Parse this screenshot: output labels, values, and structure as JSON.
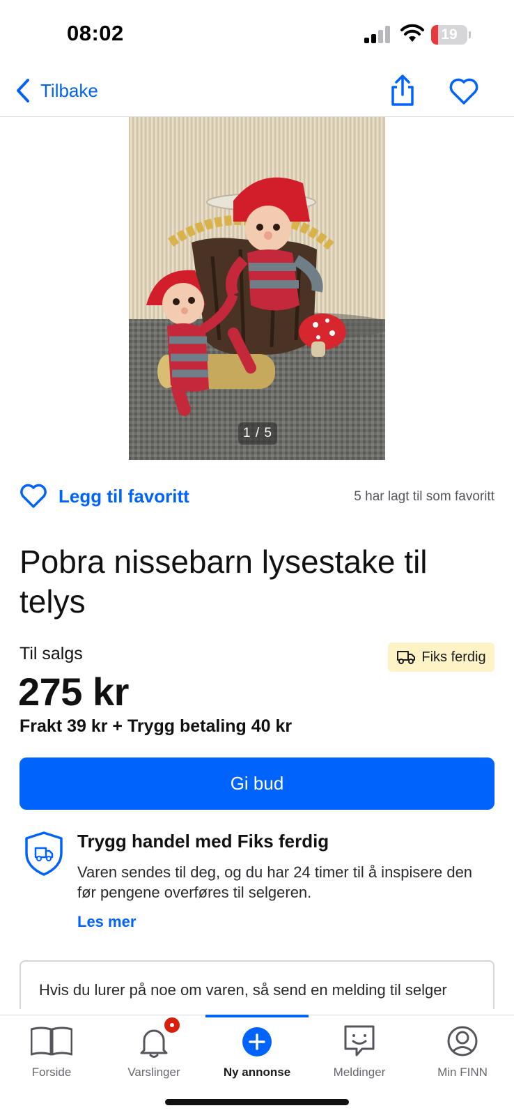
{
  "status_bar": {
    "time": "08:02",
    "battery_level": "19"
  },
  "nav": {
    "back_label": "Tilbake",
    "share_icon": "share-icon",
    "favorite_icon": "heart-outline-icon"
  },
  "gallery": {
    "counter": "1 / 5"
  },
  "favorite": {
    "add_label": "Legg til favoritt",
    "count_text": "5 har lagt til som favoritt"
  },
  "listing": {
    "title": "Pobra nissebarn lysestake til telys",
    "sale_label": "Til salgs",
    "badge_label": "Fiks ferdig",
    "price": "275 kr",
    "shipping": "Frakt 39 kr + Trygg betaling 40 kr"
  },
  "bid_button": {
    "label": "Gi bud"
  },
  "safe_trade": {
    "title": "Trygg handel med Fiks ferdig",
    "text": "Varen sendes til deg, og du har 24 timer til å inspisere den før pengene overføres til selgeren.",
    "read_more": "Les mer"
  },
  "message": {
    "text": "Hvis du lurer på noe om varen, så send en melding til selger"
  },
  "tab_bar": {
    "tabs": [
      {
        "label": "Forside",
        "icon": "book-icon"
      },
      {
        "label": "Varslinger",
        "icon": "bell-icon"
      },
      {
        "label": "Ny annonse",
        "icon": "plus-circle-icon"
      },
      {
        "label": "Meldinger",
        "icon": "chat-icon"
      },
      {
        "label": "Min FINN",
        "icon": "profile-icon"
      }
    ],
    "active_index": 2
  },
  "colors": {
    "accent": "#0063fb",
    "badge_bg": "#fdf3c6",
    "notification": "#d91f0a",
    "battery_low": "#e9383c"
  }
}
